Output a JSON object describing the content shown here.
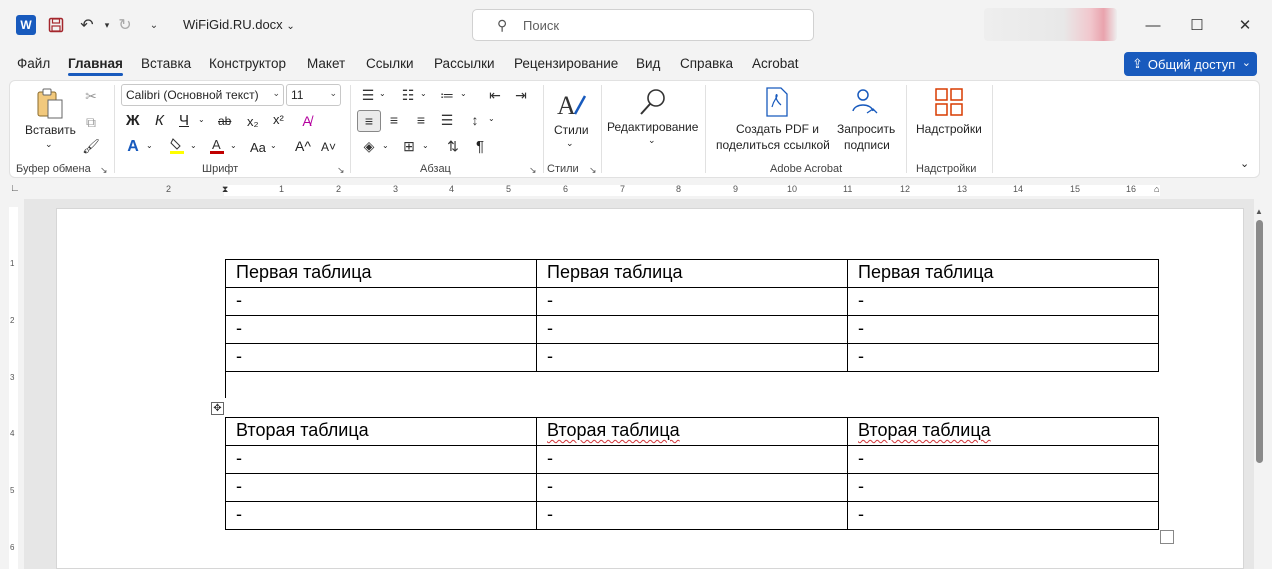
{
  "titlebar": {
    "app_icon": "W",
    "doc_title": "WiFiGid.RU.docx",
    "search_placeholder": "Поиск"
  },
  "menu": {
    "tabs": [
      "Файл",
      "Главная",
      "Вставка",
      "Конструктор",
      "Макет",
      "Ссылки",
      "Рассылки",
      "Рецензирование",
      "Вид",
      "Справка",
      "Acrobat"
    ],
    "active": "Главная",
    "share_label": "Общий доступ"
  },
  "ribbon": {
    "clipboard": {
      "paste_label": "Вставить",
      "group": "Буфер обмена"
    },
    "font": {
      "font_name": "Calibri (Основной текст)",
      "font_size": "11",
      "bold": "Ж",
      "italic": "К",
      "underline": "Ч",
      "strike": "ab",
      "subscript": "x₂",
      "superscript": "x²",
      "case": "Aa",
      "grow": "A^",
      "shrink": "A˅",
      "group": "Шрифт"
    },
    "paragraph": {
      "group": "Абзац",
      "pilcrow": "¶"
    },
    "styles": {
      "label": "Стили",
      "group": "Стили"
    },
    "editing": {
      "label": "Редактирование"
    },
    "acrobat": {
      "create_pdf_line1": "Создать PDF и",
      "create_pdf_line2": "поделиться ссылкой",
      "sign_line1": "Запросить",
      "sign_line2": "подписи",
      "group": "Adobe Acrobat"
    },
    "addins": {
      "label": "Надстройки",
      "group": "Надстройки"
    }
  },
  "ruler": {
    "h_numbers": [
      "2",
      "1",
      "1",
      "2",
      "3",
      "4",
      "5",
      "6",
      "7",
      "8",
      "9",
      "10",
      "11",
      "12",
      "13",
      "14",
      "15",
      "16"
    ],
    "v_numbers": [
      "1",
      "2",
      "3",
      "4",
      "5",
      "6"
    ]
  },
  "document": {
    "table1": {
      "header": [
        "Первая таблица",
        "Первая таблица",
        "Первая таблица"
      ],
      "rows": [
        [
          "-",
          "-",
          "-"
        ],
        [
          "-",
          "-",
          "-"
        ],
        [
          "-",
          "-",
          "-"
        ]
      ]
    },
    "table2": {
      "header": [
        "Вторая таблица",
        "Вторая таблица",
        "Вторая таблица"
      ],
      "rows": [
        [
          "-",
          "-",
          "-"
        ],
        [
          "-",
          "-",
          "-"
        ],
        [
          "-",
          "-",
          "-"
        ]
      ]
    }
  },
  "colors": {
    "accent": "#185abd",
    "highlight": "#ffff00",
    "font_color": "#c00000",
    "spell_error": "#d13438"
  }
}
